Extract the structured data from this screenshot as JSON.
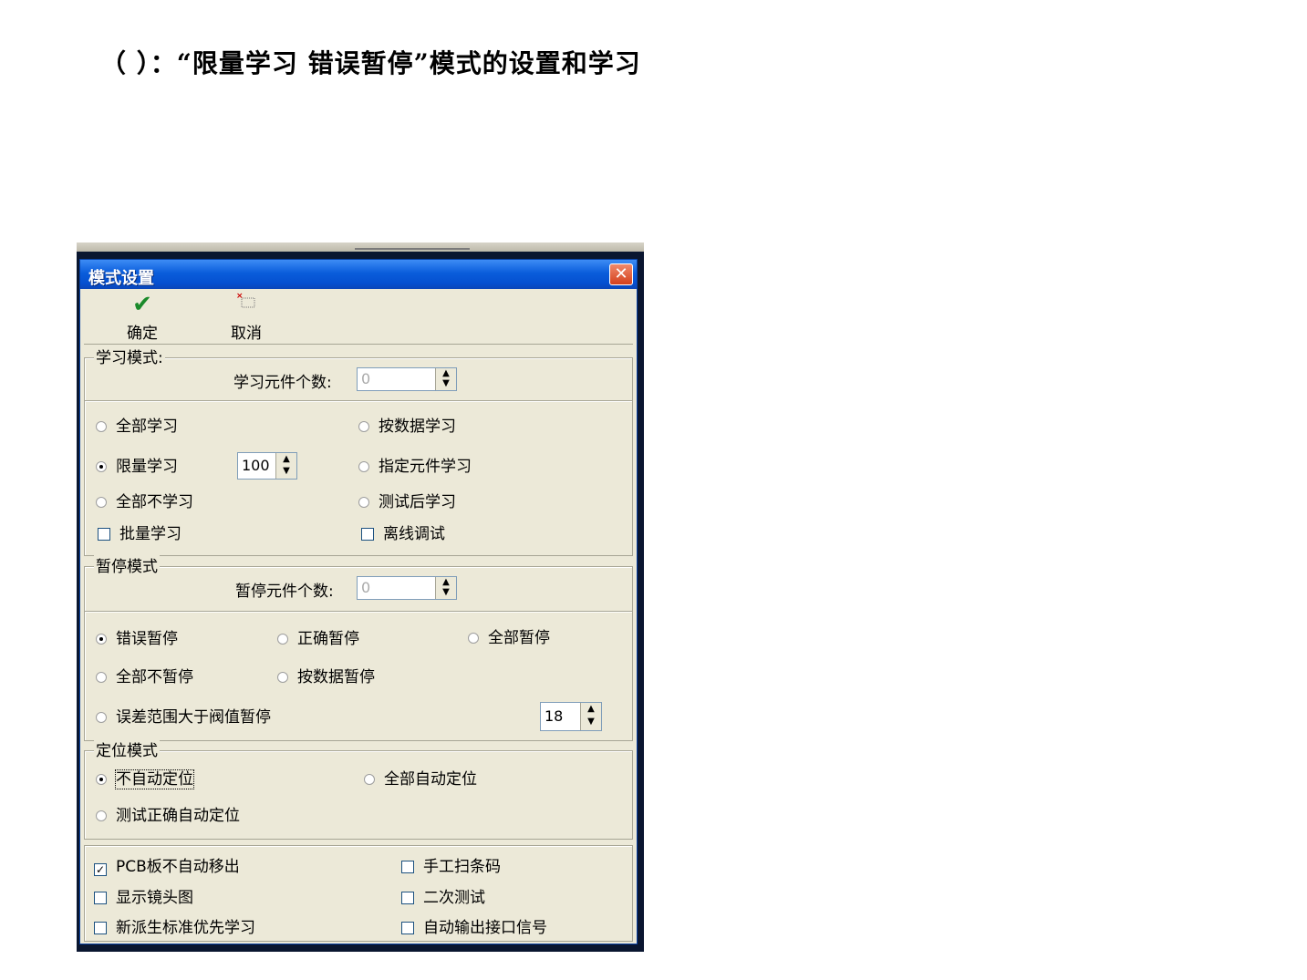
{
  "doc": {
    "heading": "（ ）：“限量学习 错误暂停”模式的设置和学习"
  },
  "window": {
    "title": "模式设置",
    "close_symbol": "✕"
  },
  "toolbar": {
    "ok_label": "确定",
    "cancel_label": "取消",
    "ok_icon": "checkmark-icon",
    "cancel_icon": "cancel-icon"
  },
  "learn_mode": {
    "title": "学习模式:",
    "count_label": "学习元件个数:",
    "count_value": "0",
    "options": [
      {
        "label": "全部学习",
        "selected": false
      },
      {
        "label": "按数据学习",
        "selected": false
      },
      {
        "label": "限量学习",
        "selected": true
      },
      {
        "label": "指定元件学习",
        "selected": false
      },
      {
        "label": "全部不学习",
        "selected": false
      },
      {
        "label": "测试后学习",
        "selected": false
      }
    ],
    "limit_value": "100",
    "checks": [
      {
        "label": "批量学习",
        "checked": false
      },
      {
        "label": "离线调试",
        "checked": false
      }
    ]
  },
  "pause_mode": {
    "title": "暂停模式",
    "count_label": "暂停元件个数:",
    "count_value": "0",
    "options": [
      {
        "label": "错误暂停",
        "selected": true
      },
      {
        "label": "正确暂停",
        "selected": false
      },
      {
        "label": "全部暂停",
        "selected": false
      },
      {
        "label": "全部不暂停",
        "selected": false
      },
      {
        "label": "按数据暂停",
        "selected": false
      },
      {
        "label": "误差范围大于阀值暂停",
        "selected": false
      }
    ],
    "threshold_value": "18"
  },
  "position_mode": {
    "title": "定位模式",
    "options": [
      {
        "label": "不自动定位",
        "selected": true
      },
      {
        "label": "全部自动定位",
        "selected": false
      },
      {
        "label": "测试正确自动定位",
        "selected": false
      }
    ]
  },
  "misc": {
    "checks": [
      {
        "label": "PCB板不自动移出",
        "checked": true
      },
      {
        "label": "手工扫条码",
        "checked": false
      },
      {
        "label": "显示镜头图",
        "checked": false
      },
      {
        "label": "二次测试",
        "checked": false
      },
      {
        "label": "新派生标准优先学习",
        "checked": false
      },
      {
        "label": "自动输出接口信号",
        "checked": false
      }
    ]
  }
}
